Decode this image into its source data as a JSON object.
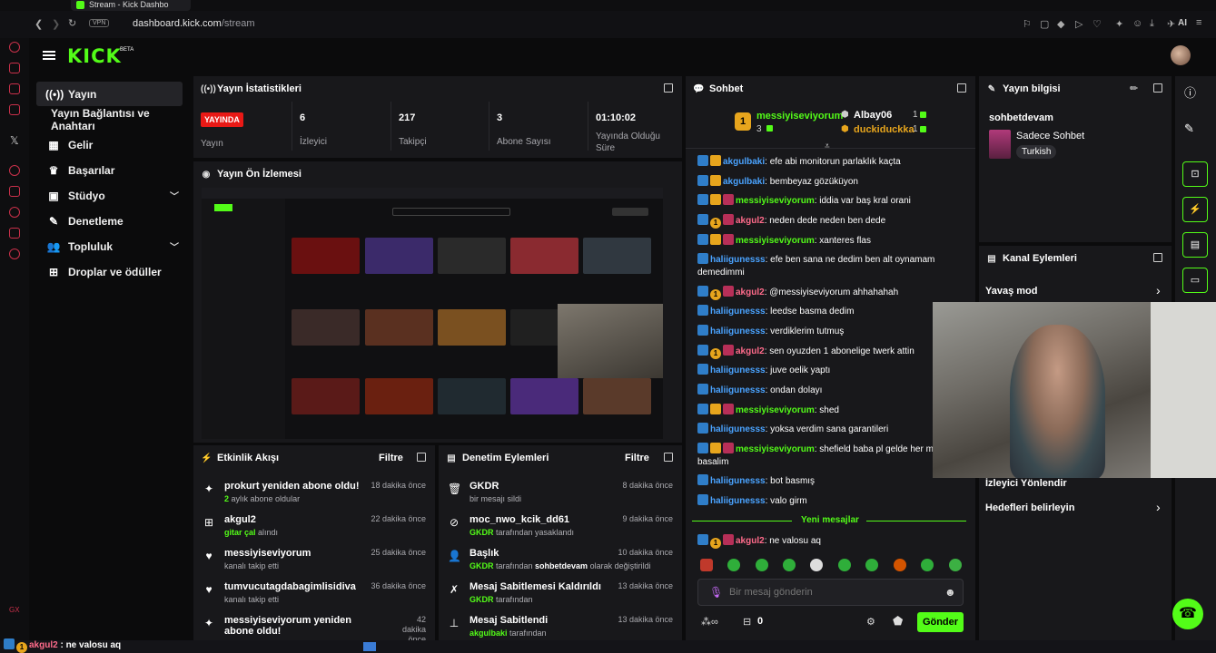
{
  "browser": {
    "tab_title": "Stream - Kick Dashbo",
    "url_host": "dashboard.kick.com",
    "url_path": "/stream",
    "vpn_label": "VPN",
    "ai_label": "AI"
  },
  "header": {
    "logo": "KICK",
    "logo_badge": "BETA"
  },
  "nav": {
    "items": [
      {
        "label": "Yayın",
        "icon": "broadcast-icon",
        "active": true
      },
      {
        "label": "Yayın Bağlantısı ve Anahtarı",
        "icon": "",
        "sub": true
      },
      {
        "label": "Gelir",
        "icon": "revenue-icon"
      },
      {
        "label": "Başarılar",
        "icon": "trophy-icon"
      },
      {
        "label": "Stüdyo",
        "icon": "studio-icon",
        "expandable": true
      },
      {
        "label": "Denetleme",
        "icon": "wrench-icon"
      },
      {
        "label": "Topluluk",
        "icon": "people-icon",
        "expandable": true
      },
      {
        "label": "Droplar ve ödüller",
        "icon": "gift-icon"
      }
    ]
  },
  "stats_panel": {
    "title": "Yayın İstatistikleri",
    "live_badge": "YAYINDA",
    "live_label": "Yayın",
    "stats": [
      {
        "value": "6",
        "label": "İzleyici"
      },
      {
        "value": "217",
        "label": "Takipçi"
      },
      {
        "value": "3",
        "label": "Abone Sayısı"
      },
      {
        "value": "01:10:02",
        "label": "Yayında Olduğu Süre"
      }
    ]
  },
  "preview_panel": {
    "title": "Yayın Ön İzlemesi"
  },
  "activity_panel": {
    "title": "Etkinlik Akışı",
    "filter": "Filtre",
    "rows": [
      {
        "icon": "sparkle-icon",
        "title": "prokurt yeniden abone oldu!",
        "sub_strong": "2",
        "sub": " aylık abone oldular",
        "time": "18 dakika önce"
      },
      {
        "icon": "gift-icon",
        "title": "akgul2",
        "sub_strong": "gitar çal",
        "sub": " alındı",
        "time": "22 dakika önce"
      },
      {
        "icon": "heart-icon",
        "title": "messiyiseviyorum",
        "sub_strong": "",
        "sub": "kanalı takip etti",
        "time": "25 dakika önce"
      },
      {
        "icon": "heart-icon",
        "title": "tumvucutagdabagimlisidiva",
        "sub_strong": "",
        "sub": "kanalı takip etti",
        "time": "36 dakika önce"
      },
      {
        "icon": "sparkle-icon",
        "title": "messiyiseviyorum yeniden abone oldu!",
        "sub_strong": "",
        "sub": "",
        "time": "42 dakika önce"
      }
    ]
  },
  "moderation_panel": {
    "title": "Denetim Eylemleri",
    "filter": "Filtre",
    "rows": [
      {
        "icon": "trash-icon",
        "title": "GKDR",
        "sub_user": "",
        "sub": "bir mesajı sildi",
        "time": "8 dakika önce"
      },
      {
        "icon": "ban-icon",
        "title": "moc_nwo_kcik_dd61",
        "sub_user": "GKDR",
        "sub": " tarafından yasaklandı",
        "time": "9 dakika önce"
      },
      {
        "icon": "user-edit-icon",
        "title": "Başlık",
        "sub_user": "GKDR",
        "sub": " tarafından ",
        "sub_extra": "sohbetdevam",
        "sub_tail": " olarak değiştirildi",
        "time": "10 dakika önce"
      },
      {
        "icon": "unpin-icon",
        "title": "Mesaj Sabitlemesi Kaldırıldı",
        "sub_user": "GKDR",
        "sub": " tarafından",
        "time": "13 dakika önce"
      },
      {
        "icon": "pin-icon",
        "title": "Mesaj Sabitlendi",
        "sub_user": "akgulbaki",
        "sub": " tarafından",
        "time": "13 dakika önce"
      }
    ]
  },
  "chat_panel": {
    "title": "Sohbet",
    "leaderboard": [
      {
        "rank": "1",
        "name": "messiyiseviyorum",
        "count": "3"
      },
      {
        "name": "Albay06",
        "count": "1"
      },
      {
        "name": "duckiduckka",
        "count": "1"
      }
    ],
    "messages": [
      {
        "badges": [
          "b-blue",
          "b-crown"
        ],
        "user": "akgulbaki",
        "color": "c-blue",
        "text": ": efe abi monitorun parlaklık kaçta"
      },
      {
        "badges": [
          "b-blue",
          "b-crown"
        ],
        "user": "akgulbaki",
        "color": "c-blue",
        "text": ": bembeyaz gözüküyon"
      },
      {
        "badges": [
          "b-blue",
          "b-crown",
          "b-pink"
        ],
        "user": "messiyiseviyorum",
        "color": "c-green",
        "text": ": iddia var baş kral orani"
      },
      {
        "badges": [
          "b-blue",
          "b-gold",
          "b-pink"
        ],
        "user": "akgul2",
        "color": "c-pink",
        "text": ": neden dede neden ben dede"
      },
      {
        "badges": [
          "b-blue",
          "b-crown",
          "b-pink"
        ],
        "user": "messiyiseviyorum",
        "color": "c-green",
        "text": ": xanteres flas"
      },
      {
        "badges": [
          "b-blue"
        ],
        "user": "haliigunesss",
        "color": "c-blue",
        "text": ": efe ben sana ne dedim ben alt oynamam demedimmi"
      },
      {
        "badges": [
          "b-blue",
          "b-gold",
          "b-pink"
        ],
        "user": "akgul2",
        "color": "c-pink",
        "text": ": @messiyiseviyorum ahhahahah"
      },
      {
        "badges": [
          "b-blue"
        ],
        "user": "haliigunesss",
        "color": "c-blue",
        "text": ": leedse basma dedim"
      },
      {
        "badges": [
          "b-blue"
        ],
        "user": "haliigunesss",
        "color": "c-blue",
        "text": ": verdiklerim tutmuş"
      },
      {
        "badges": [
          "b-blue",
          "b-gold",
          "b-pink"
        ],
        "user": "akgul2",
        "color": "c-pink",
        "text": ": sen oyuzden 1 abonelige twerk attin"
      },
      {
        "badges": [
          "b-blue"
        ],
        "user": "haliigunesss",
        "color": "c-blue",
        "text": ": juve oelik yaptı"
      },
      {
        "badges": [
          "b-blue"
        ],
        "user": "haliigunesss",
        "color": "c-blue",
        "text": ": ondan dolayı"
      },
      {
        "badges": [
          "b-blue",
          "b-crown",
          "b-pink"
        ],
        "user": "messiyiseviyorum",
        "color": "c-green",
        "text": ": shed"
      },
      {
        "badges": [
          "b-blue"
        ],
        "user": "haliigunesss",
        "color": "c-blue",
        "text": ": yoksa verdim sana garantileri"
      },
      {
        "badges": [
          "b-blue",
          "b-crown",
          "b-pink"
        ],
        "user": "messiyiseviyorum",
        "color": "c-green",
        "text": ": shefield baba pl gelde her ma basalim"
      },
      {
        "badges": [
          "b-blue"
        ],
        "user": "haliigunesss",
        "color": "c-blue",
        "text": ": bot basmış"
      },
      {
        "badges": [
          "b-blue"
        ],
        "user": "haliigunesss",
        "color": "c-blue",
        "text": ": valo girm"
      }
    ],
    "new_messages_label": "Yeni mesajlar",
    "new_message": {
      "badges": [
        "b-blue",
        "b-gold",
        "b-pink"
      ],
      "user": "akgul2",
      "color": "c-pink",
      "text": ": ne valosu aq"
    },
    "input_placeholder": "Bir mesaj gönderin",
    "points": "0",
    "send_label": "Gönder"
  },
  "info_panel": {
    "title": "Yayın bilgisi",
    "stream_title": "sohbetdevam",
    "category": "Sadece Sohbet",
    "tag": "Turkish"
  },
  "channel_actions": {
    "title": "Kanal Eylemleri",
    "items": [
      "Yavaş mod",
      "İzleyici Yönlendir",
      "Hedefleri belirleyin"
    ]
  },
  "overlay_chat": {
    "user": "akgul2",
    "text": " : ne valosu aq"
  },
  "colors": {
    "brand": "#53fc18",
    "panel": "#18181b",
    "bg": "#0b0b0c",
    "live": "#e91916"
  }
}
